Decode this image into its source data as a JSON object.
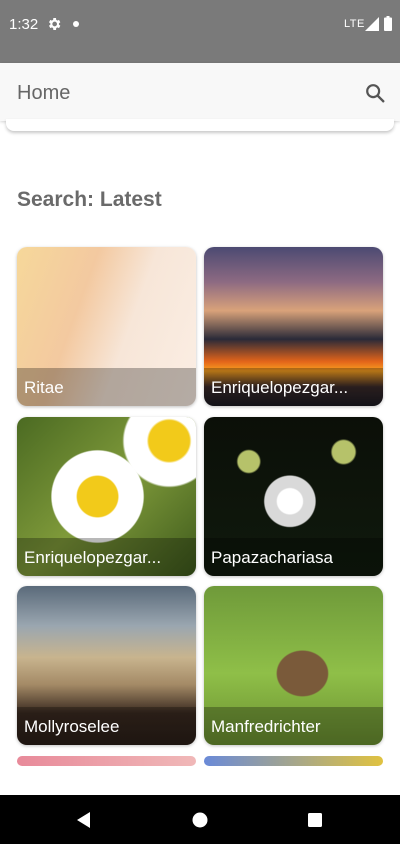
{
  "status_bar": {
    "time": "1:32",
    "network": "LTE",
    "icons": [
      "gear-icon",
      "notification-dot-icon",
      "signal-icon",
      "battery-icon"
    ]
  },
  "app_bar": {
    "title": "Home",
    "search_icon": "search-icon"
  },
  "section": {
    "heading": "Search: Latest"
  },
  "results": [
    {
      "author": "Ritae",
      "subject": "baby-hand"
    },
    {
      "author": "Enriquelopezgar...",
      "subject": "sunset"
    },
    {
      "author": "Enriquelopezgar...",
      "subject": "daisy"
    },
    {
      "author": "Papazachariasa",
      "subject": "dandelion"
    },
    {
      "author": "Mollyroselee",
      "subject": "desert"
    },
    {
      "author": "Manfredrichter",
      "subject": "ducks"
    }
  ],
  "nav_bar": {
    "buttons": [
      "back-icon",
      "home-icon",
      "recents-icon"
    ]
  },
  "colors": {
    "status_bar": "#7a7a7a",
    "app_bar": "#f8f8f8",
    "title_text": "#666666",
    "nav_bar": "#000000"
  }
}
